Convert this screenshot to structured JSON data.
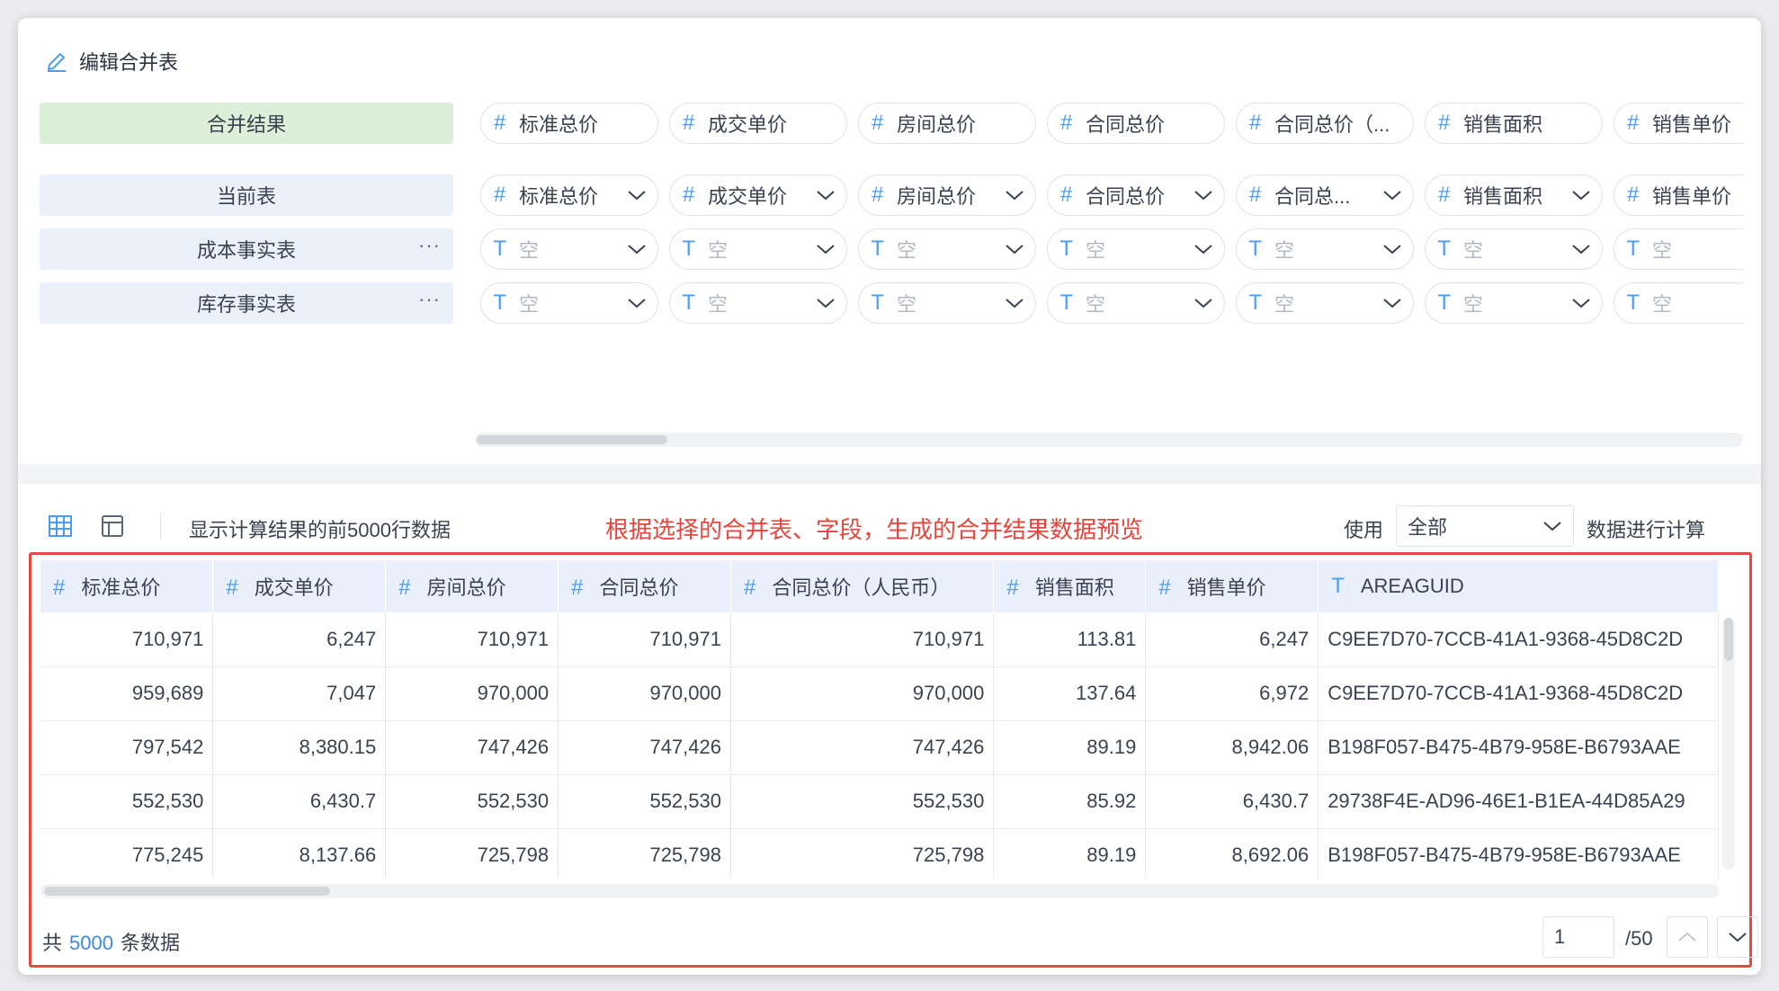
{
  "header": {
    "title": "编辑合并表"
  },
  "rows": {
    "result_label": "合并结果",
    "current_label": "当前表",
    "tables": [
      {
        "label": "成本事实表",
        "more": "···"
      },
      {
        "label": "库存事实表",
        "more": "···"
      }
    ]
  },
  "result_fields": [
    {
      "type": "#",
      "name": "标准总价"
    },
    {
      "type": "#",
      "name": "成交单价"
    },
    {
      "type": "#",
      "name": "房间总价"
    },
    {
      "type": "#",
      "name": "合同总价"
    },
    {
      "type": "#",
      "name": "合同总价（..."
    },
    {
      "type": "#",
      "name": "销售面积"
    },
    {
      "type": "#",
      "name": "销售单价"
    }
  ],
  "current_fields": [
    {
      "type": "#",
      "name": "标准总价"
    },
    {
      "type": "#",
      "name": "成交单价"
    },
    {
      "type": "#",
      "name": "房间总价"
    },
    {
      "type": "#",
      "name": "合同总价"
    },
    {
      "type": "#",
      "name": "合同总..."
    },
    {
      "type": "#",
      "name": "销售面积"
    },
    {
      "type": "#",
      "name": "销售单价"
    }
  ],
  "empty_field": {
    "type": "T",
    "name": "空"
  },
  "preview": {
    "info": "显示计算结果的前5000行数据",
    "note": "根据选择的合并表、字段，生成的合并结果数据预览",
    "use_label": "使用",
    "use_value": "全部",
    "calc_label": "数据进行计算",
    "columns": [
      {
        "type": "#",
        "name": "标准总价"
      },
      {
        "type": "#",
        "name": "成交单价"
      },
      {
        "type": "#",
        "name": "房间总价"
      },
      {
        "type": "#",
        "name": "合同总价"
      },
      {
        "type": "#",
        "name": "合同总价（人民币）"
      },
      {
        "type": "#",
        "name": "销售面积"
      },
      {
        "type": "#",
        "name": "销售单价"
      },
      {
        "type": "T",
        "name": "AREAGUID"
      }
    ],
    "rows": [
      [
        "710,971",
        "6,247",
        "710,971",
        "710,971",
        "710,971",
        "113.81",
        "6,247",
        "C9EE7D70-7CCB-41A1-9368-45D8C2D"
      ],
      [
        "959,689",
        "7,047",
        "970,000",
        "970,000",
        "970,000",
        "137.64",
        "6,972",
        "C9EE7D70-7CCB-41A1-9368-45D8C2D"
      ],
      [
        "797,542",
        "8,380.15",
        "747,426",
        "747,426",
        "747,426",
        "89.19",
        "8,942.06",
        "B198F057-B475-4B79-958E-B6793AAE"
      ],
      [
        "552,530",
        "6,430.7",
        "552,530",
        "552,530",
        "552,530",
        "85.92",
        "6,430.7",
        "29738F4E-AD96-46E1-B1EA-44D85A29"
      ],
      [
        "775,245",
        "8,137.66",
        "725,798",
        "725,798",
        "725,798",
        "89.19",
        "8,692.06",
        "B198F057-B475-4B79-958E-B6793AAE"
      ]
    ],
    "footer": {
      "prefix": "共",
      "count": "5000",
      "suffix": "条数据"
    },
    "pager": {
      "page": "1",
      "total": "/50"
    }
  },
  "colors": {
    "accent": "#4a9df2",
    "note": "#e8453c",
    "result_bg": "#dbefd9",
    "row_bg": "#ebf1fb"
  }
}
